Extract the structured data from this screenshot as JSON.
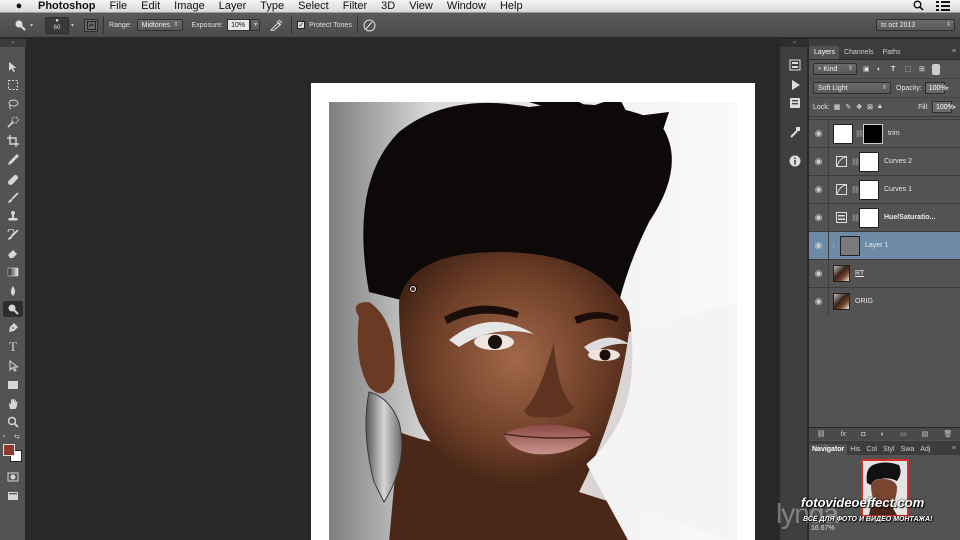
{
  "menubar": {
    "app": "Photoshop",
    "items": [
      "File",
      "Edit",
      "Image",
      "Layer",
      "Type",
      "Select",
      "Filter",
      "3D",
      "View",
      "Window",
      "Help"
    ]
  },
  "options": {
    "brush_size": "60",
    "range_label": "Range:",
    "range_value": "Midtones",
    "exposure_label": "Exposure:",
    "exposure_value": "10%",
    "protect_tones": "Protect Tones",
    "workspace": "ts oct 2013"
  },
  "layers_panel": {
    "tabs": [
      "Layers",
      "Channels",
      "Paths"
    ],
    "filter": "Kind",
    "blend_mode": "Soft Light",
    "opacity_label": "Opacity:",
    "opacity_value": "100%",
    "lock_label": "Lock:",
    "fill_label": "Fill:",
    "fill_value": "100%",
    "layers": [
      {
        "name": "trim",
        "type": "mask",
        "selected": false
      },
      {
        "name": "Curves 2",
        "type": "curves",
        "selected": false
      },
      {
        "name": "Curves 1",
        "type": "curves",
        "selected": false
      },
      {
        "name": "Hue/Saturatio...",
        "type": "huesat",
        "selected": false
      },
      {
        "name": "Layer 1",
        "type": "gray",
        "selected": true
      },
      {
        "name": "RT",
        "type": "photo",
        "selected": false
      },
      {
        "name": "ORIG",
        "type": "photo",
        "selected": false
      }
    ]
  },
  "navigator": {
    "tabs": [
      "Navigator",
      "His",
      "Col",
      "Styl",
      "Swa",
      "Adj"
    ],
    "zoom": "16.67%"
  },
  "watermark": {
    "line1": "fotovideoeffect.com",
    "line2": "ВСЁ ДЛЯ ФОТО И ВИДЕО МОНТАЖА!",
    "lynda": "lynda"
  },
  "colors": {
    "selected_layer": "#6d8aa6",
    "foreground": "#8b3a32",
    "background": "#ffffff"
  }
}
